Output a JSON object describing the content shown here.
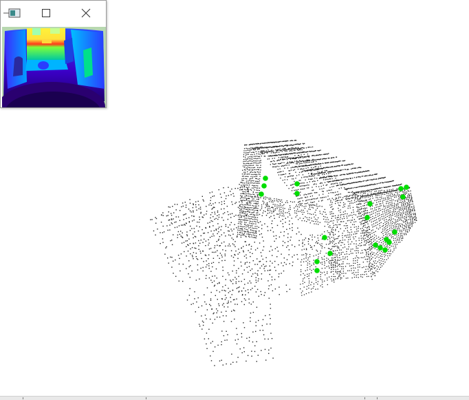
{
  "window": {
    "title": "",
    "controls": [
      "app-icon",
      "maximize-icon",
      "close-icon"
    ]
  },
  "depth_view": {
    "colormap": [
      "#1a0060",
      "#3b00c8",
      "#2a4cff",
      "#00b4ff",
      "#00e08a",
      "#7cff3a",
      "#fff23a",
      "#ff3a1a"
    ]
  },
  "point_cloud": {
    "point_color": "#222222",
    "keypoint_color": "#00dd00"
  }
}
